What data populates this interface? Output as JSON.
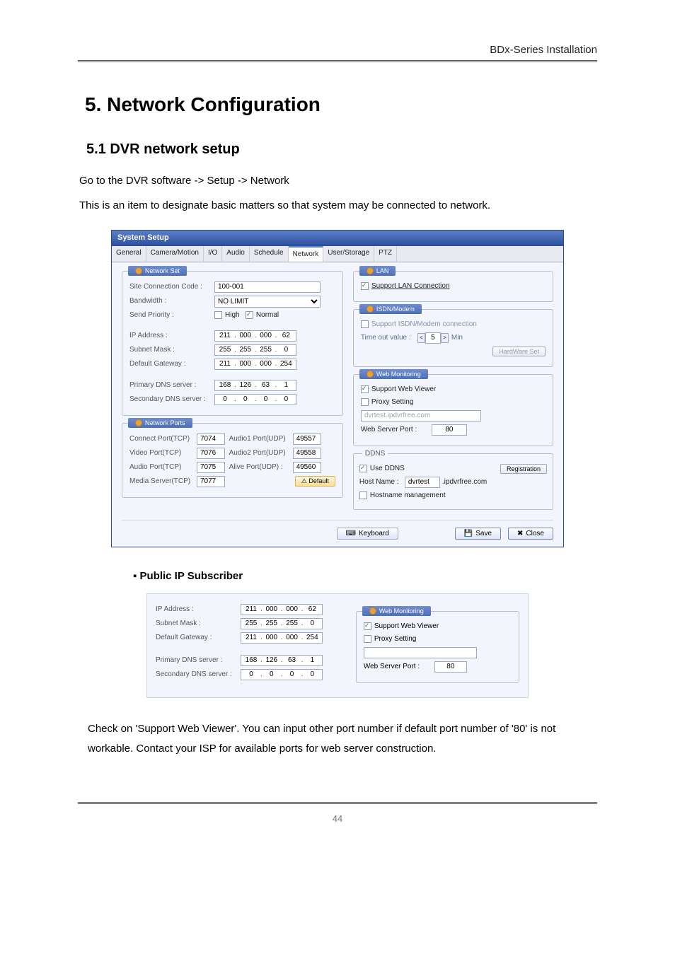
{
  "header": {
    "series": "BDx-Series Installation"
  },
  "h1": "5. Network Configuration",
  "h2": "5.1 DVR network setup",
  "intro1": "Go to the DVR software -> Setup -> Network",
  "intro2": "This is an item to designate basic matters so that system may be connected to network.",
  "bullet": "▪  Public IP Subscriber",
  "para2": "Check on 'Support Web Viewer'. You can input other port number if default port number of '80' is not workable. Contact your ISP for available ports for web server construction.",
  "pagenum": "44",
  "window": {
    "title": "System Setup",
    "tabs": [
      "General",
      "Camera/Motion",
      "I/O",
      "Audio",
      "Schedule",
      "Network",
      "User/Storage",
      "PTZ"
    ],
    "activeTab": 5,
    "networkSet": {
      "legend": "Network Set",
      "siteCodeLabel": "Site Connection Code :",
      "siteCode": "100-001",
      "bandwidthLabel": "Bandwidth :",
      "bandwidth": "NO LIMIT",
      "sendPriorityLabel": "Send Priority :",
      "priorityHigh": "High",
      "priorityNormal": "Normal",
      "ipLabel": "IP Address :",
      "ip": [
        "211",
        "000",
        "000",
        "62"
      ],
      "subnetLabel": "Subnet Mask :",
      "subnet": [
        "255",
        "255",
        "255",
        "0"
      ],
      "gatewayLabel": "Default Gateway :",
      "gateway": [
        "211",
        "000",
        "000",
        "254"
      ],
      "dns1Label": "Primary DNS server :",
      "dns1": [
        "168",
        "126",
        "63",
        "1"
      ],
      "dns2Label": "Secondary DNS server :",
      "dns2": [
        "0",
        "0",
        "0",
        "0"
      ]
    },
    "networkPorts": {
      "legend": "Network Ports",
      "connectLabel": "Connect Port(TCP)",
      "connect": "7074",
      "videoLabel": "Video Port(TCP)",
      "video": "7076",
      "audioLabel": "Audio Port(TCP)",
      "audio": "7075",
      "mediaLabel": "Media Server(TCP)",
      "media": "7077",
      "audio1uLabel": "Audio1 Port(UDP)",
      "audio1u": "49557",
      "audio2uLabel": "Audio2 Port(UDP)",
      "audio2u": "49558",
      "aliveLabel": "Alive Port(UDP) :",
      "alive": "49560",
      "defaultBtn": "Default"
    },
    "lan": {
      "legend": "LAN",
      "supportLan": "Support LAN Connection"
    },
    "isdn": {
      "legend": "ISDN/Modem",
      "supportLabel": "Support ISDN/Modem connection",
      "timeoutLabel": "Time out value :",
      "timeoutValue": "5",
      "timeoutUnit": "Min",
      "hwBtn": "HardWare Set"
    },
    "webMon": {
      "legend": "Web Monitoring",
      "supportViewer": "Support Web Viewer",
      "proxyLabel": "Proxy Setting",
      "proxyVal": "dvrtest.ipdvrfree.com",
      "webPortLabel": "Web Server Port :",
      "webPort": "80"
    },
    "ddns": {
      "title": "DDNS",
      "useDdns": "Use DDNS",
      "regBtn": "Registration",
      "hostLabel": "Host Name :",
      "hostPrefix": "dvrtest",
      "hostSuffix": ".ipdvrfree.com",
      "mgmtLabel": "Hostname management"
    },
    "footer": {
      "keyboard": "Keyboard",
      "save": "Save",
      "close": "Close"
    }
  },
  "snippet": {
    "ipLabel": "IP Address :",
    "ip": [
      "211",
      "000",
      "000",
      "62"
    ],
    "subnetLabel": "Subnet Mask :",
    "subnet": [
      "255",
      "255",
      "255",
      "0"
    ],
    "gatewayLabel": "Default Gateway :",
    "gateway": [
      "211",
      "000",
      "000",
      "254"
    ],
    "dns1Label": "Primary DNS server :",
    "dns1": [
      "168",
      "126",
      "63",
      "1"
    ],
    "dns2Label": "Secondary DNS server :",
    "dns2": [
      "0",
      "0",
      "0",
      "0"
    ],
    "webMonLegend": "Web Monitoring",
    "supportViewer": "Support Web Viewer",
    "proxyLabel": "Proxy Setting",
    "webPortLabel": "Web Server Port :",
    "webPort": "80"
  }
}
